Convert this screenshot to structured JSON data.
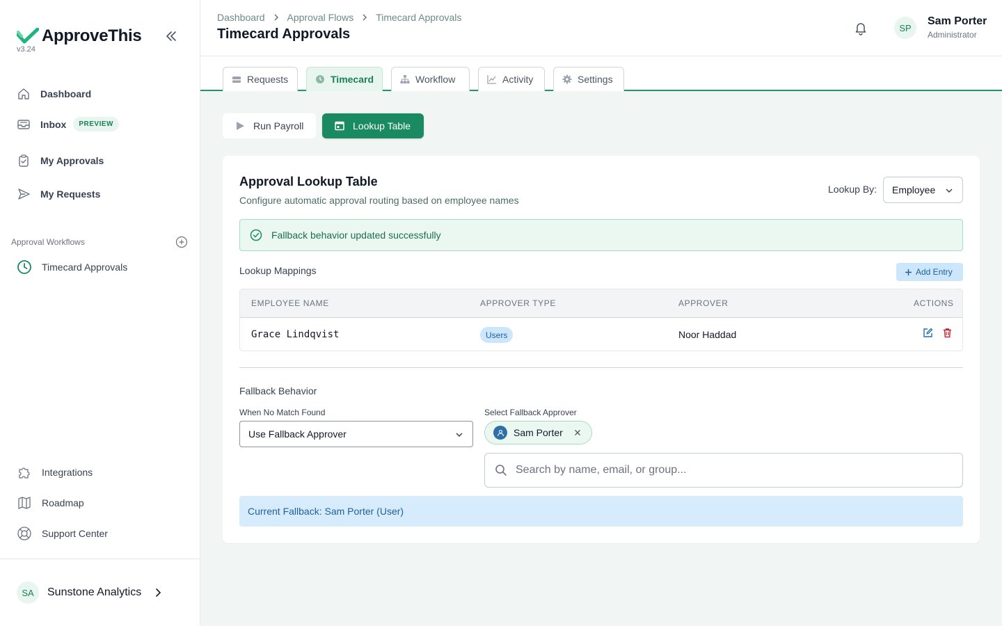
{
  "app": {
    "name": "ApproveThis",
    "version": "v3.24"
  },
  "sidebar": {
    "nav": [
      {
        "label": "Dashboard",
        "icon": "home-icon"
      },
      {
        "label": "Inbox",
        "icon": "inbox-icon",
        "badge": "PREVIEW"
      },
      {
        "label": "My Approvals",
        "icon": "clipboard-check-icon"
      },
      {
        "label": "My Requests",
        "icon": "send-icon"
      }
    ],
    "section_label": "Approval Workflows",
    "workflows": [
      {
        "label": "Timecard Approvals",
        "icon": "clock-icon"
      }
    ],
    "footer_nav": [
      {
        "label": "Integrations",
        "icon": "puzzle-icon"
      },
      {
        "label": "Roadmap",
        "icon": "map-icon"
      },
      {
        "label": "Support Center",
        "icon": "lifebuoy-icon"
      }
    ],
    "org": {
      "initials": "SA",
      "name": "Sunstone Analytics"
    }
  },
  "header": {
    "breadcrumb": [
      "Dashboard",
      "Approval Flows",
      "Timecard Approvals"
    ],
    "title": "Timecard Approvals",
    "user": {
      "initials": "SP",
      "name": "Sam Porter",
      "role": "Administrator"
    }
  },
  "tabs": [
    {
      "label": "Requests",
      "active": false
    },
    {
      "label": "Timecard",
      "active": true
    },
    {
      "label": "Workflow",
      "active": false
    },
    {
      "label": "Activity",
      "active": false
    },
    {
      "label": "Settings",
      "active": false
    }
  ],
  "actions": {
    "run_payroll": "Run Payroll",
    "lookup_table": "Lookup Table"
  },
  "card": {
    "title": "Approval Lookup Table",
    "subtitle": "Configure automatic approval routing based on employee names",
    "lookup_by_label": "Lookup By:",
    "lookup_by_value": "Employee",
    "success_message": "Fallback behavior updated successfully",
    "mappings_label": "Lookup Mappings",
    "add_entry": "Add Entry",
    "columns": [
      "EMPLOYEE NAME",
      "APPROVER TYPE",
      "APPROVER",
      "ACTIONS"
    ],
    "rows": [
      {
        "employee": "Grace Lindqvist",
        "approver_type": "Users",
        "approver": "Noor Haddad"
      }
    ],
    "fallback": {
      "title": "Fallback Behavior",
      "when_label": "When No Match Found",
      "when_value": "Use Fallback Approver",
      "select_label": "Select Fallback Approver",
      "selected": "Sam Porter",
      "search_placeholder": "Search by name, email, or group...",
      "current": "Current Fallback: Sam Porter (User)"
    }
  },
  "colors": {
    "accent": "#1a8a63",
    "accent_light": "#e8f6ef",
    "info": "#cce6fb",
    "danger": "#c0262d"
  }
}
